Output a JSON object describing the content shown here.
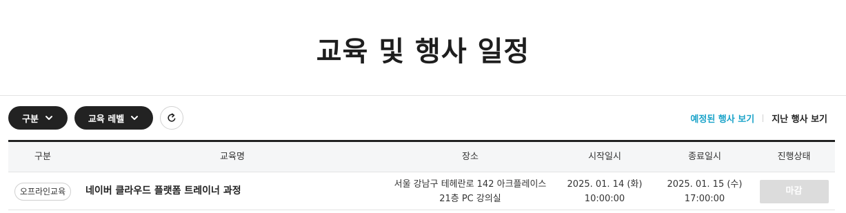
{
  "page": {
    "title": "교육 및 행사 일정"
  },
  "filters": {
    "type_label": "구분",
    "level_label": "교육 레벨",
    "reset_icon": "refresh-icon"
  },
  "view_links": {
    "upcoming": "예정된 행사 보기",
    "past": "지난 행사 보기",
    "active_color": "#1aa3c9"
  },
  "table": {
    "headers": [
      "구분",
      "교육명",
      "장소",
      "시작일시",
      "종료일시",
      "진행상태"
    ],
    "rows": [
      {
        "category": "오프라인교육",
        "name": "네이버 클라우드 플랫폼 트레이너 과정",
        "place_line1": "서울 강남구 테헤란로 142 아크플레이스",
        "place_line2": "21층 PC 강의실",
        "start_date": "2025. 01. 14 (화)",
        "start_time": "10:00:00",
        "end_date": "2025. 01. 15 (수)",
        "end_time": "17:00:00",
        "status": "마감"
      }
    ]
  }
}
